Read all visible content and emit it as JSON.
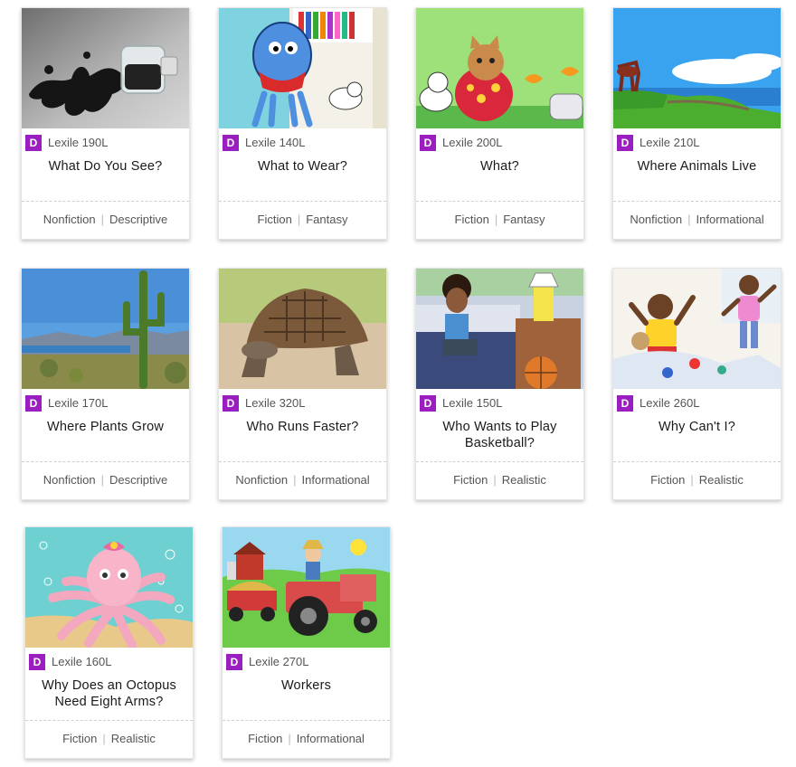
{
  "accent_color": "#9b1ec0",
  "level_badge": "D",
  "books": [
    {
      "lexile": "Lexile 190L",
      "title": "What Do You See?",
      "genre": "Nonfiction",
      "subgenre": "Descriptive",
      "image": "ink-bottle-image"
    },
    {
      "lexile": "Lexile 140L",
      "title": "What to Wear?",
      "genre": "Fiction",
      "subgenre": "Fantasy",
      "image": "blue-monster-image"
    },
    {
      "lexile": "Lexile 200L",
      "title": "What?",
      "genre": "Fiction",
      "subgenre": "Fantasy",
      "image": "cats-toaster-image"
    },
    {
      "lexile": "Lexile 210L",
      "title": "Where Animals Live",
      "genre": "Nonfiction",
      "subgenre": "Informational",
      "image": "coast-landscape-image"
    },
    {
      "lexile": "Lexile 170L",
      "title": "Where Plants Grow",
      "genre": "Nonfiction",
      "subgenre": "Descriptive",
      "image": "desert-cactus-image"
    },
    {
      "lexile": "Lexile 320L",
      "title": "Who Runs Faster?",
      "genre": "Nonfiction",
      "subgenre": "Informational",
      "image": "tortoise-image"
    },
    {
      "lexile": "Lexile 150L",
      "title": "Who Wants to Play Basketball?",
      "genre": "Fiction",
      "subgenre": "Realistic",
      "image": "boy-bedroom-image"
    },
    {
      "lexile": "Lexile 260L",
      "title": "Why Can't I?",
      "genre": "Fiction",
      "subgenre": "Realistic",
      "image": "kids-playing-image"
    },
    {
      "lexile": "Lexile 160L",
      "title": "Why Does an Octopus Need Eight Arms?",
      "genre": "Fiction",
      "subgenre": "Realistic",
      "image": "octopus-image"
    },
    {
      "lexile": "Lexile 270L",
      "title": "Workers",
      "genre": "Fiction",
      "subgenre": "Informational",
      "image": "tractor-farm-image"
    }
  ]
}
